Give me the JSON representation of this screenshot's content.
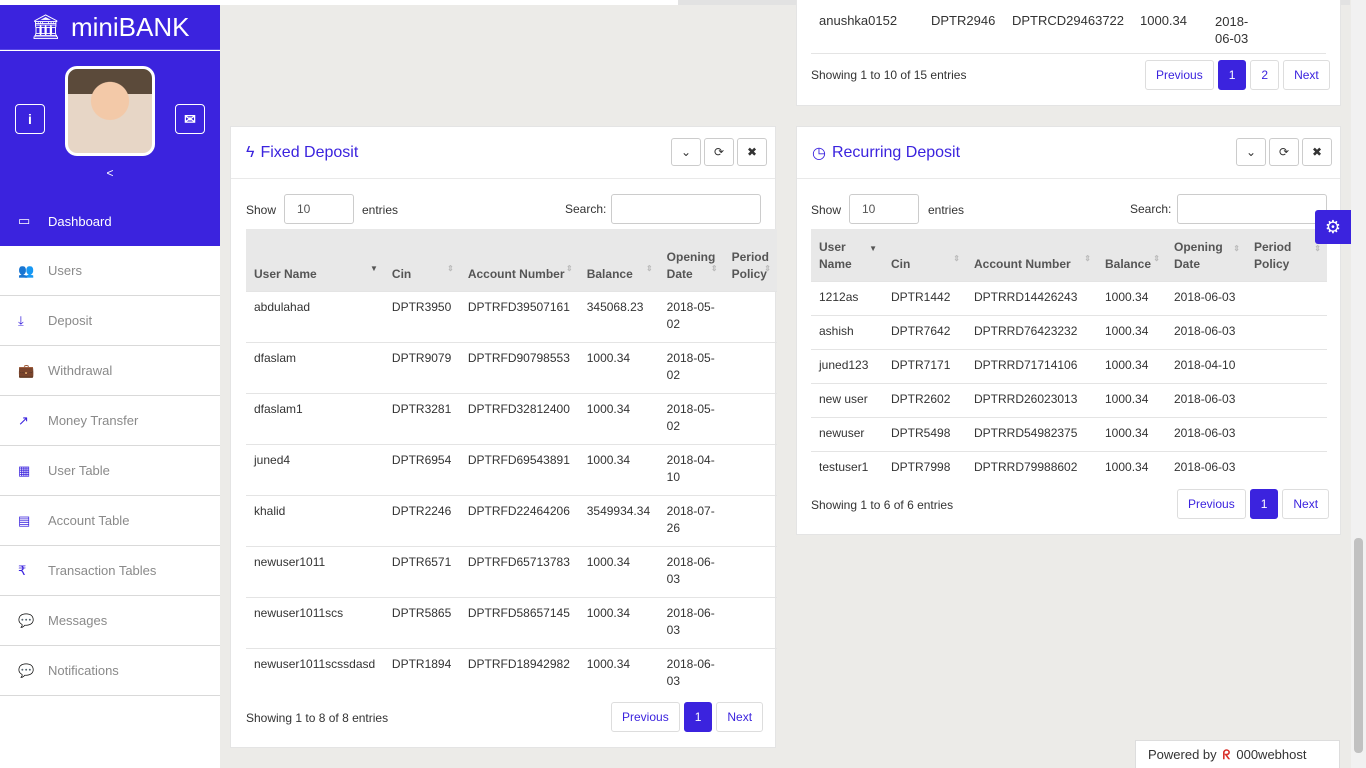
{
  "brand": {
    "icon": "bank-icon",
    "name": "miniBANK"
  },
  "profile": {
    "info_icon": "i",
    "mail_icon": "✉",
    "collapse": "<"
  },
  "menu": [
    {
      "label": "Dashboard",
      "icon": "▭",
      "active": true
    },
    {
      "label": "Users",
      "icon": "👥"
    },
    {
      "label": "Deposit",
      "icon": "⤓"
    },
    {
      "label": "Withdrawal",
      "icon": "💼"
    },
    {
      "label": "Money Transfer",
      "icon": "↗"
    },
    {
      "label": "User Table",
      "icon": "▦"
    },
    {
      "label": "Account Table",
      "icon": "▤"
    },
    {
      "label": "Transaction Tables",
      "icon": "₹"
    },
    {
      "label": "Messages",
      "icon": "💬"
    },
    {
      "label": "Notifications",
      "icon": "💬"
    }
  ],
  "top_panel": {
    "row": [
      "anushka0152",
      "DPTR2946",
      "DPTRCD29463722",
      "1000.34",
      "2018-06-03"
    ],
    "info": "Showing 1 to 10 of 15 entries",
    "pager": {
      "prev": "Previous",
      "pages": [
        "1",
        "2"
      ],
      "next": "Next"
    }
  },
  "fixed": {
    "icon": "ϟ",
    "title": "Fixed Deposit",
    "show": "Show",
    "length": "10",
    "entries": "entries",
    "search_label": "Search:",
    "columns": [
      "User Name",
      "Cin",
      "Account Number",
      "Balance",
      "Opening Date",
      "Period Policy"
    ],
    "rows": [
      [
        "abdulahad",
        "DPTR3950",
        "DPTRFD39507161",
        "345068.23",
        "2018-05-02",
        ""
      ],
      [
        "dfaslam",
        "DPTR9079",
        "DPTRFD90798553",
        "1000.34",
        "2018-05-02",
        ""
      ],
      [
        "dfaslam1",
        "DPTR3281",
        "DPTRFD32812400",
        "1000.34",
        "2018-05-02",
        ""
      ],
      [
        "juned4",
        "DPTR6954",
        "DPTRFD69543891",
        "1000.34",
        "2018-04-10",
        ""
      ],
      [
        "khalid",
        "DPTR2246",
        "DPTRFD22464206",
        "3549934.34",
        "2018-07-26",
        ""
      ],
      [
        "newuser1011",
        "DPTR6571",
        "DPTRFD65713783",
        "1000.34",
        "2018-06-03",
        ""
      ],
      [
        "newuser1011scs",
        "DPTR5865",
        "DPTRFD58657145",
        "1000.34",
        "2018-06-03",
        ""
      ],
      [
        "newuser1011scssdasd",
        "DPTR1894",
        "DPTRFD18942982",
        "1000.34",
        "2018-06-03",
        ""
      ]
    ],
    "info": "Showing 1 to 8 of 8 entries",
    "pager": {
      "prev": "Previous",
      "page": "1",
      "next": "Next"
    }
  },
  "recurring": {
    "icon": "◷",
    "title": "Recurring Deposit",
    "show": "Show",
    "length": "10",
    "entries": "entries",
    "search_label": "Search:",
    "columns": [
      "User Name",
      "Cin",
      "Account Number",
      "Balance",
      "Opening Date",
      "Period Policy"
    ],
    "rows": [
      [
        "1212as",
        "DPTR1442",
        "DPTRRD14426243",
        "1000.34",
        "2018-06-03",
        ""
      ],
      [
        "ashish",
        "DPTR7642",
        "DPTRRD76423232",
        "1000.34",
        "2018-06-03",
        ""
      ],
      [
        "juned123",
        "DPTR7171",
        "DPTRRD71714106",
        "1000.34",
        "2018-04-10",
        ""
      ],
      [
        "new user",
        "DPTR2602",
        "DPTRRD26023013",
        "1000.34",
        "2018-06-03",
        ""
      ],
      [
        "newuser",
        "DPTR5498",
        "DPTRRD54982375",
        "1000.34",
        "2018-06-03",
        ""
      ],
      [
        "testuser1",
        "DPTR7998",
        "DPTRRD79988602",
        "1000.34",
        "2018-06-03",
        ""
      ]
    ],
    "info": "Showing 1 to 6 of 6 entries",
    "pager": {
      "prev": "Previous",
      "page": "1",
      "next": "Next"
    }
  },
  "tools": {
    "collapse": "⌄",
    "refresh": "⟳",
    "close": "✖"
  },
  "gear": "⚙",
  "powered": {
    "text": "Powered by",
    "logo": "ᖇ",
    "host": "000webhost"
  },
  "colors": {
    "accent": "#3b23de"
  }
}
